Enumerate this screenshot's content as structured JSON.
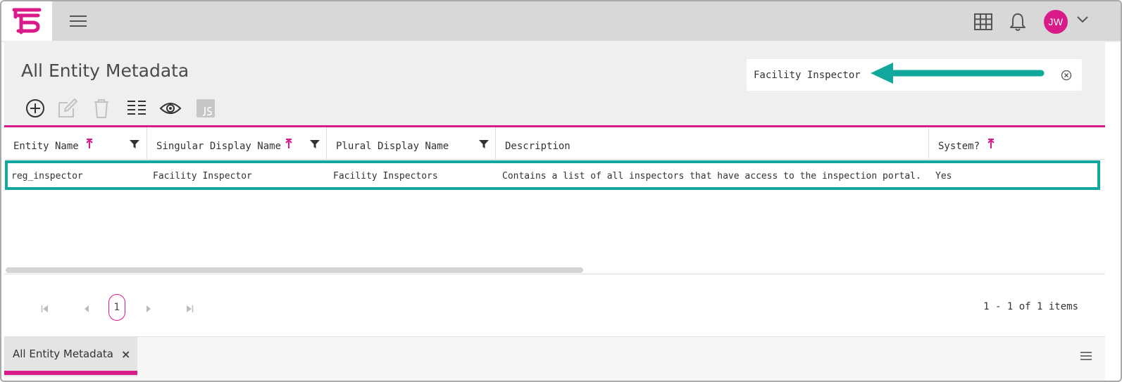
{
  "colors": {
    "brand": "#d81b88",
    "annotation": "#13a89e",
    "topbar": "#d8d8d8",
    "content_bg": "#efefef"
  },
  "topbar": {
    "logo_icon": "brand-logo",
    "menu_icon": "hamburger-menu-icon",
    "apps_icon": "grid-icon",
    "notifications_icon": "bell-icon",
    "user_initials": "JW",
    "user_menu_icon": "chevron-down-icon"
  },
  "page": {
    "title": "All Entity Metadata"
  },
  "search": {
    "value": "Facility Inspector",
    "clear_icon": "clear-circle-icon"
  },
  "toolbar": {
    "buttons": [
      {
        "icon": "add-circle-icon",
        "enabled": true
      },
      {
        "icon": "edit-icon",
        "enabled": false
      },
      {
        "icon": "trash-icon",
        "enabled": false
      },
      {
        "icon": "columns-icon",
        "enabled": true
      },
      {
        "icon": "eye-icon",
        "enabled": true
      },
      {
        "icon": "js-icon",
        "enabled": false
      }
    ]
  },
  "grid": {
    "columns": [
      {
        "label": "Entity Name",
        "sortable": true,
        "filterable": true
      },
      {
        "label": "Singular Display Name",
        "sortable": true,
        "filterable": true
      },
      {
        "label": "Plural Display Name",
        "sortable": false,
        "filterable": true
      },
      {
        "label": "Description",
        "sortable": false,
        "filterable": false
      },
      {
        "label": "System?",
        "sortable": true,
        "filterable": false
      }
    ],
    "rows": [
      {
        "entity_name": "reg_inspector",
        "singular": "Facility Inspector",
        "plural": "Facility Inspectors",
        "description": "Contains a list of all inspectors that have access to the inspection portal. …",
        "system": "Yes"
      }
    ]
  },
  "pager": {
    "current_page": "1",
    "info": "1 - 1 of 1 items"
  },
  "tabs": [
    {
      "label": "All Entity Metadata",
      "close": "×"
    }
  ]
}
